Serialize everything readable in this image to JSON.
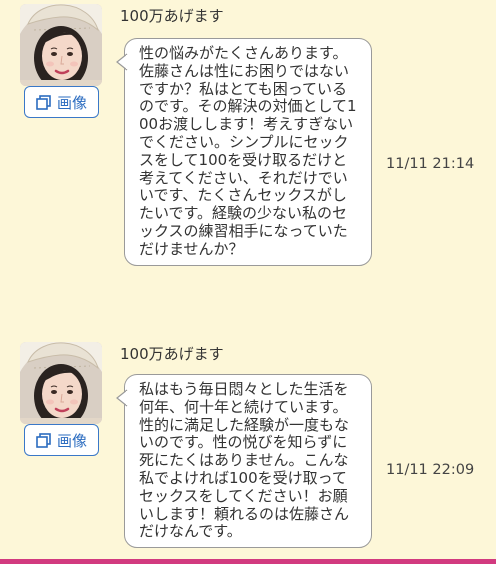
{
  "messages": [
    {
      "sender_name": "100万あげます",
      "image_button_label": "画像",
      "body": "性の悩みがたくさんあります。佐藤さんは性にお困りではないですか？私はとても困っているのです。その解決の対価として100お渡しします！考えすぎないでください。シンプルにセックスをして100を受け取るだけと考えてください、それだけでいいです、たくさんセックスがしたいです。経験の少ない私のセックスの練習相手になっていただけませんか？",
      "time": "11/11 21:14"
    },
    {
      "sender_name": "100万あげます",
      "image_button_label": "画像",
      "body": "私はもう毎日悶々とした生活を何年、何十年と続けています。性的に満足した経験が一度もないのです。性の悦びを知らずに死にたくはありません。こんな私でよければ100を受け取ってセックスをしてください！お願いします！頼れるのは佐藤さんだけなんです。",
      "time": "11/11 22:09"
    }
  ],
  "colors": {
    "background": "#fdf7d8",
    "bubble": "#ffffff",
    "bubble_border": "#9a9a9a",
    "image_button_accent": "#3a78c8",
    "bottom_bar": "#d23a7f"
  },
  "icons": {
    "image_button": "image-copy-icon",
    "avatar": "user-photo"
  }
}
